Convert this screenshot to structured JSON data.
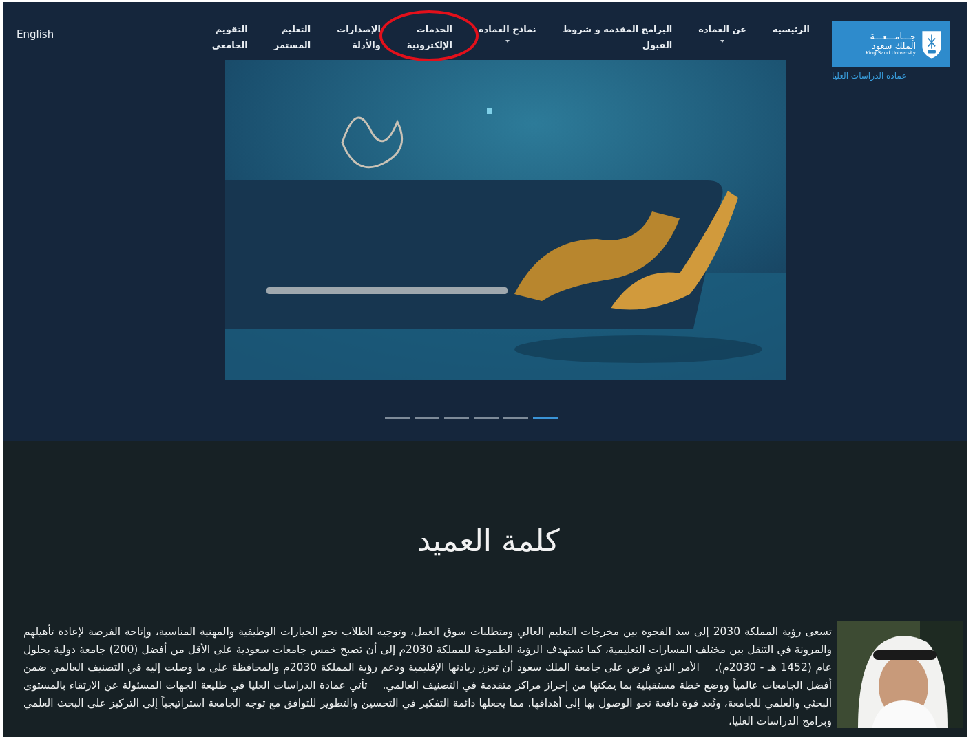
{
  "logo": {
    "line_1": "جـــامـــعـــة",
    "line_2": "الملك سعود",
    "line_3": "King Saud University",
    "caption": "عمادة الدراسات العليا"
  },
  "nav": [
    {
      "label": "الرئيسية",
      "dropdown": false,
      "highlighted": false
    },
    {
      "label": "عن العمادة",
      "dropdown": true,
      "highlighted": false
    },
    {
      "label": "البرامج المقدمة و شروط\nالقبول",
      "dropdown": false,
      "highlighted": false
    },
    {
      "label": "نماذج العمادة",
      "dropdown": true,
      "highlighted": false
    },
    {
      "label": "الخدمات\nالإلكترونية",
      "dropdown": false,
      "highlighted": true
    },
    {
      "label": "الإصدارات\nوالأدلة",
      "dropdown": false,
      "highlighted": false
    },
    {
      "label": "التعليم\nالمستمر",
      "dropdown": false,
      "highlighted": false
    },
    {
      "label": "التقويم\nالجامعي",
      "dropdown": false,
      "highlighted": false
    }
  ],
  "language_link": "English",
  "slider": {
    "kind": "picture",
    "slides": [
      {
        "selected": true
      },
      {
        "selected": false
      },
      {
        "selected": false
      },
      {
        "selected": false
      },
      {
        "selected": false
      },
      {
        "selected": false
      }
    ]
  },
  "dean_message": {
    "title": "كلمة العميد",
    "text": "تسعى رؤية المملكة 2030 إلى سد الفجوة بين مخرجات التعليم العالي ومتطلبات سوق العمل، وتوجيه الطلاب نحو الخيارات الوظيفية والمهنية المناسبة، وإتاحة الفرصة لإعادة تأهيلهم والمرونة في التنقل بين مختلف المسارات التعليمية، كما تستهدف الرؤية الطموحة للمملكة 2030م إلى أن تصبح خمس جامعات سعودية على الأقل من أفضل (200) جامعة دولية بحلول عام (1452 هـ - 2030م).    الأمر الذي فرض على جامعة الملك سعود أن تعزز ريادتها الإقليمية ودعم رؤية المملكة 2030م والمحافظة على ما وصلت إليه في التصنيف العالمي ضمن أفضل الجامعات عالمياً ووضع خطة مستقبلية بما يمكنها من إحراز مراكز متقدمة في التصنيف العالمي.    تأتي عمادة الدراسات العليا في طليعة الجهات المسئولة عن الارتقاء بالمستوى البحثي والعلمي للجامعة، وتُعد قوة دافعة نحو الوصول بها إلى أهدافها. مما يجعلها دائمة التفكير في التحسين والتطوير للتوافق مع توجه الجامعة استراتيجياً إلى التركيز على البحث العلمي وبرامج الدراسات العليا،"
  }
}
